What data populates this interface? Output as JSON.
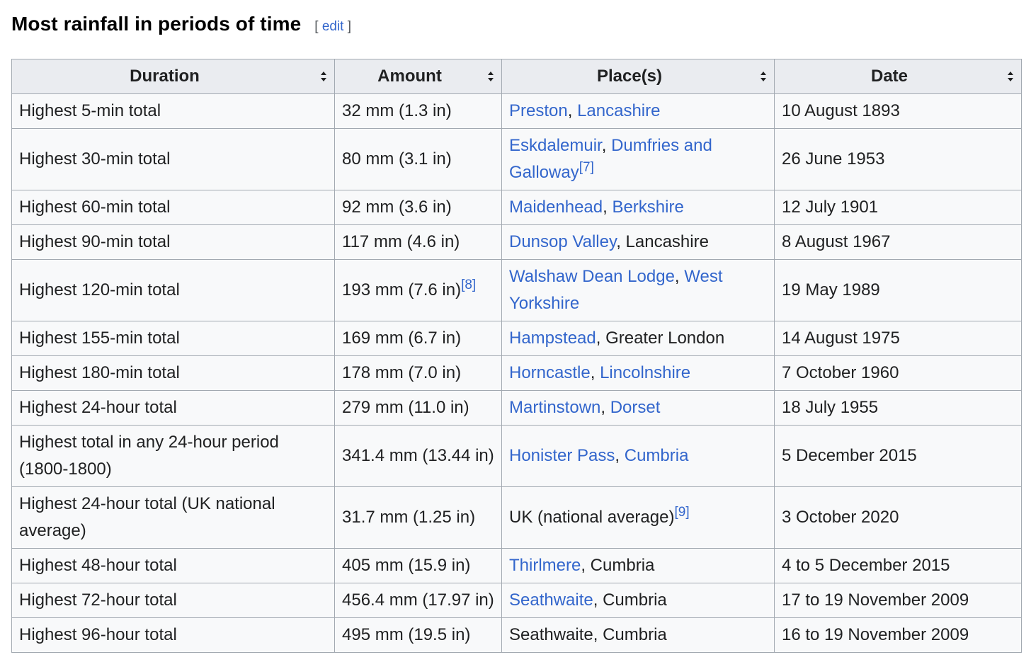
{
  "section": {
    "title": "Most rainfall in periods of time",
    "edit_open": "[",
    "edit_label": "edit",
    "edit_close": "]"
  },
  "table": {
    "headers": [
      "Duration",
      "Amount",
      "Place(s)",
      "Date"
    ],
    "rows": [
      {
        "duration": "Highest 5-min total",
        "amount": "32 mm (1.3 in)",
        "amount_ref": "",
        "place": [
          {
            "text": "Preston",
            "link": true
          },
          {
            "text": ", ",
            "link": false
          },
          {
            "text": "Lancashire",
            "link": true
          }
        ],
        "place_ref": "",
        "date": "10 August 1893"
      },
      {
        "duration": "Highest 30-min total",
        "amount": "80 mm (3.1 in)",
        "amount_ref": "",
        "place": [
          {
            "text": "Eskdalemuir",
            "link": true
          },
          {
            "text": ", ",
            "link": false
          },
          {
            "text": "Dumfries and Galloway",
            "link": true
          }
        ],
        "place_ref": "[7]",
        "date": "26 June 1953"
      },
      {
        "duration": "Highest 60-min total",
        "amount": "92 mm (3.6 in)",
        "amount_ref": "",
        "place": [
          {
            "text": "Maidenhead",
            "link": true
          },
          {
            "text": ", ",
            "link": false
          },
          {
            "text": "Berkshire",
            "link": true
          }
        ],
        "place_ref": "",
        "date": "12 July 1901"
      },
      {
        "duration": "Highest 90-min total",
        "amount": "117 mm (4.6 in)",
        "amount_ref": "",
        "place": [
          {
            "text": "Dunsop Valley",
            "link": true
          },
          {
            "text": ", Lancashire",
            "link": false
          }
        ],
        "place_ref": "",
        "date": "8 August 1967"
      },
      {
        "duration": "Highest 120-min total",
        "amount": "193 mm (7.6 in)",
        "amount_ref": "[8]",
        "place": [
          {
            "text": "Walshaw Dean Lodge",
            "link": true
          },
          {
            "text": ", ",
            "link": false
          },
          {
            "text": "West Yorkshire",
            "link": true
          }
        ],
        "place_ref": "",
        "date": "19 May 1989"
      },
      {
        "duration": "Highest 155-min total",
        "amount": "169 mm (6.7 in)",
        "amount_ref": "",
        "place": [
          {
            "text": "Hampstead",
            "link": true
          },
          {
            "text": ", Greater London",
            "link": false
          }
        ],
        "place_ref": "",
        "date": "14 August 1975"
      },
      {
        "duration": "Highest 180-min total",
        "amount": "178 mm (7.0 in)",
        "amount_ref": "",
        "place": [
          {
            "text": "Horncastle",
            "link": true
          },
          {
            "text": ", ",
            "link": false
          },
          {
            "text": "Lincolnshire",
            "link": true
          }
        ],
        "place_ref": "",
        "date": "7 October 1960"
      },
      {
        "duration": "Highest 24-hour total",
        "amount": "279 mm (11.0 in)",
        "amount_ref": "",
        "place": [
          {
            "text": "Martinstown",
            "link": true
          },
          {
            "text": ", ",
            "link": false
          },
          {
            "text": "Dorset",
            "link": true
          }
        ],
        "place_ref": "",
        "date": "18 July 1955"
      },
      {
        "duration": "Highest total in any 24-hour period (1800-1800)",
        "amount": "341.4 mm (13.44 in)",
        "amount_ref": "",
        "place": [
          {
            "text": "Honister Pass",
            "link": true
          },
          {
            "text": ", ",
            "link": false
          },
          {
            "text": "Cumbria",
            "link": true
          }
        ],
        "place_ref": "",
        "date": "5 December 2015"
      },
      {
        "duration": "Highest 24-hour total (UK national average)",
        "amount": "31.7 mm (1.25 in)",
        "amount_ref": "",
        "place": [
          {
            "text": "UK (national average)",
            "link": false
          }
        ],
        "place_ref": "[9]",
        "date": "3 October 2020"
      },
      {
        "duration": "Highest 48-hour total",
        "amount": "405 mm (15.9 in)",
        "amount_ref": "",
        "place": [
          {
            "text": "Thirlmere",
            "link": true
          },
          {
            "text": ", Cumbria",
            "link": false
          }
        ],
        "place_ref": "",
        "date": "4 to 5 December 2015"
      },
      {
        "duration": "Highest 72-hour total",
        "amount": "456.4 mm (17.97 in)",
        "amount_ref": "",
        "place": [
          {
            "text": "Seathwaite",
            "link": true
          },
          {
            "text": ", Cumbria",
            "link": false
          }
        ],
        "place_ref": "",
        "date": "17 to 19 November 2009"
      },
      {
        "duration": "Highest 96-hour total",
        "amount": "495 mm (19.5 in)",
        "amount_ref": "",
        "place": [
          {
            "text": "Seathwaite, Cumbria",
            "link": false
          }
        ],
        "place_ref": "",
        "date": "16 to 19 November 2009"
      }
    ]
  },
  "icons": {
    "sort": "sort-arrows-icon"
  },
  "colors": {
    "link": "#3366cc",
    "header_bg": "#eaecf0",
    "cell_bg": "#f8f9fa",
    "border": "#a2a9b1"
  }
}
